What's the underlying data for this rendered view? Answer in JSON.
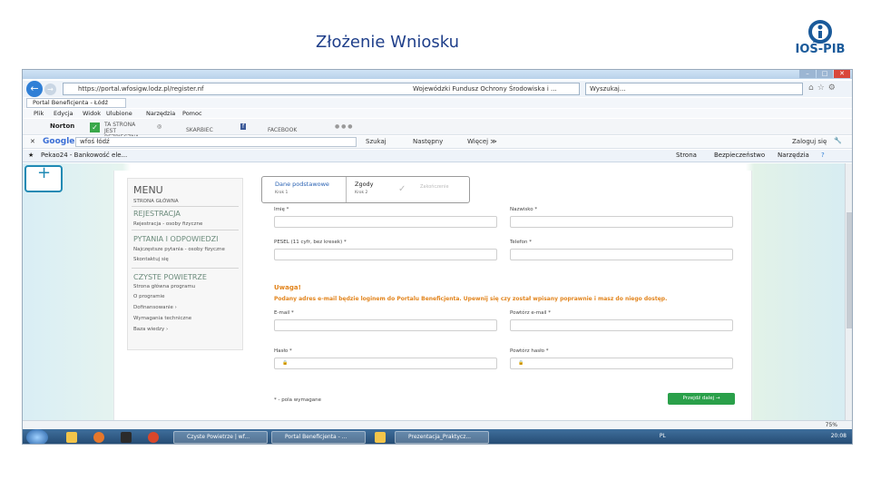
{
  "slide": {
    "title": "Złożenie Wniosku",
    "logo_text": "IOŚ-PIB"
  },
  "browser": {
    "url": "https://portal.wfosigw.lodz.pl/register.nf",
    "site_tab": "Wojewódzki Fundusz Ochrony Środowiska i ...",
    "search_placeholder": "Wyszukaj...",
    "tab_label": "Portal Beneficjenta - Łódź",
    "menu": [
      "Plik",
      "Edycja",
      "Widok",
      "Ulubione",
      "Narzędzia",
      "Pomoc"
    ],
    "norton": {
      "logo": "Norton",
      "safe_label": "TA STRONA JEST BEZPIECZNA",
      "vault_label": "SKARBIEC",
      "facebook_label": "FACEBOOK",
      "more": "● ● ●"
    },
    "google": {
      "logo": "Google",
      "query": "wfoś łódź",
      "search_btn": "Szukaj",
      "next_btn": "Następny",
      "more_btn": "Więcej ≫",
      "login": "Zaloguj się"
    },
    "favorites": {
      "item": "Pekao24 - Bankowość ele...",
      "strona": "Strona",
      "bezp": "Bezpieczeństwo",
      "narzedzia": "Narzędzia"
    },
    "zoom": "75%"
  },
  "menu": {
    "title": "MENU",
    "home": "STRONA GŁÓWNA",
    "sec1": "REJESTRACJA",
    "sec1_items": [
      "Rejestracja - osoby fizyczne"
    ],
    "sec2": "PYTANIA I ODPOWIEDZI",
    "sec2_items": [
      "Najczęstsze pytania - osoby fizyczne",
      "Skontaktuj się"
    ],
    "sec3": "CZYSTE POWIETRZE",
    "sec3_items": [
      "Strona główna programu",
      "O programie",
      "Dofinansowanie  ›",
      "Wymagania techniczne",
      "Baza wiedzy  ›"
    ]
  },
  "steps": {
    "s1": "Dane podstawowe",
    "s1_sub": "Krok 1",
    "s2": "Zgody",
    "s2_sub": "Krok 2",
    "s3": "Zakończenie"
  },
  "form": {
    "imie": "Imię *",
    "nazwisko": "Nazwisko *",
    "pesel": "PESEL (11 cyfr, bez kresek) *",
    "telefon": "Telefon *",
    "warn_title": "Uwaga!",
    "warn_text": "Podany adres e-mail będzie loginem do Portalu Beneficjenta. Upewnij się czy został wpisany poprawnie i masz do niego dostęp.",
    "email": "E-mail *",
    "email2": "Powtórz e-mail *",
    "haslo": "Hasło *",
    "haslo2": "Powtórz hasło *",
    "required_note": "* - pola wymagane",
    "next": "Przejdź dalej  →"
  },
  "taskbar": {
    "task1": "Czyste Powietrze | wf...",
    "task2": "Portal Beneficjenta - ...",
    "task3": "Prezentacja_Praktycz...",
    "lang": "PL",
    "time": "20:08"
  }
}
